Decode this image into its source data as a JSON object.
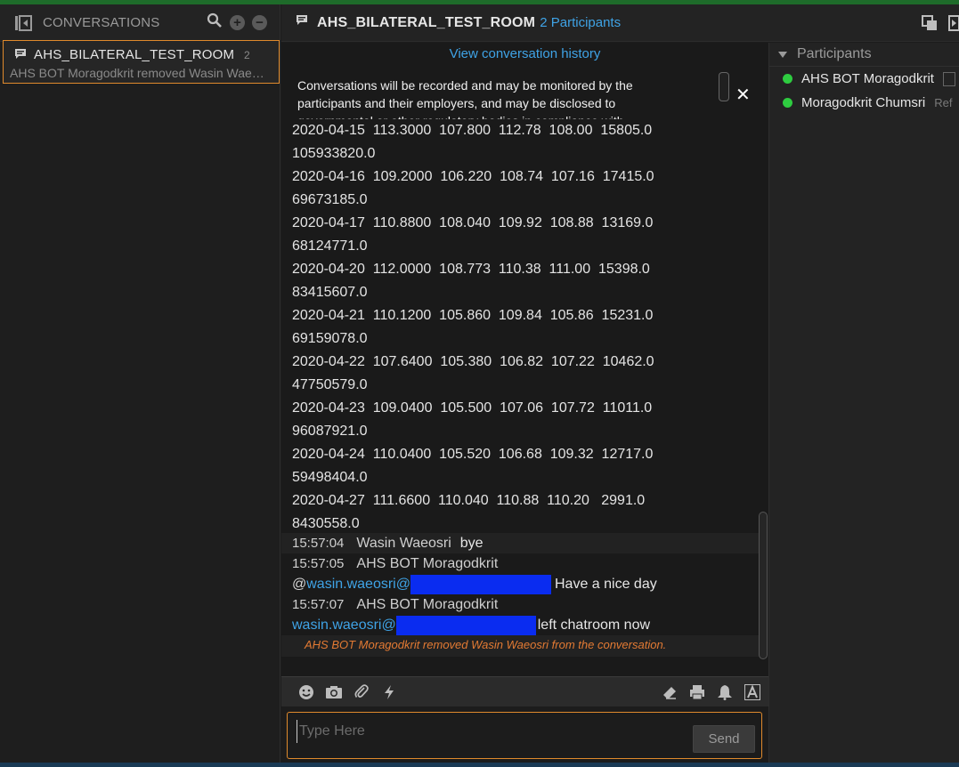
{
  "sidebar": {
    "title": "CONVERSATIONS",
    "conversations": [
      {
        "name": "AHS_BILATERAL_TEST_ROOM",
        "count": "2",
        "preview": "AHS BOT Moragodkrit removed Wasin Waeosri from the conversation."
      }
    ]
  },
  "header": {
    "room_title": "AHS_BILATERAL_TEST_ROOM",
    "participants_link": "2 Participants"
  },
  "chat": {
    "history_link": "View conversation history",
    "notice": "Conversations will be recorded and may be monitored by the participants and their employers, and may be disclosed to governmental or other regulatory bodies in compliance with",
    "data_rows": [
      {
        "line1": "2020-04-15  113.3000  107.800  112.78  108.00  15805.0",
        "line2": "105933820.0"
      },
      {
        "line1": "2020-04-16  109.2000  106.220  108.74  107.16  17415.0",
        "line2": "69673185.0"
      },
      {
        "line1": "2020-04-17  110.8800  108.040  109.92  108.88  13169.0",
        "line2": "68124771.0"
      },
      {
        "line1": "2020-04-20  112.0000  108.773  110.38  111.00  15398.0",
        "line2": "83415607.0"
      },
      {
        "line1": "2020-04-21  110.1200  105.860  109.84  105.86  15231.0",
        "line2": "69159078.0"
      },
      {
        "line1": "2020-04-22  107.6400  105.380  106.82  107.22  10462.0",
        "line2": "47750579.0"
      },
      {
        "line1": "2020-04-23  109.0400  105.500  107.06  107.72  11011.0",
        "line2": "96087921.0"
      },
      {
        "line1": "2020-04-24  110.0400  105.520  106.68  109.32  12717.0",
        "line2": "59498404.0"
      },
      {
        "line1": "2020-04-27  111.6600  110.040  110.88  110.20   2991.0",
        "line2": "8430558.0"
      }
    ],
    "messages": [
      {
        "time": "15:57:04",
        "sender": "Wasin Waeosri",
        "text": "bye"
      },
      {
        "time": "15:57:05",
        "sender": "AHS BOT Moragodkrit",
        "mention_prefix": "@",
        "mention": "wasin.waeosri@",
        "text": "Have a nice day"
      },
      {
        "time": "15:57:07",
        "sender": "AHS BOT Moragodkrit",
        "mention": "wasin.waeosri@",
        "text": "left chatroom now"
      }
    ],
    "system_message": "AHS BOT Moragodkrit removed Wasin Waeosri from the conversation."
  },
  "composer": {
    "placeholder": "Type Here",
    "send_label": "Send"
  },
  "participants_panel": {
    "title": "Participants",
    "items": [
      {
        "name": "AHS BOT Moragodkrit",
        "status": "online"
      },
      {
        "name": "Moragodkrit Chumsri",
        "extra": "Ref",
        "status": "online"
      }
    ]
  },
  "colors": {
    "accent": "#e08a2c",
    "link": "#3fa3e6",
    "online": "#2ecc40",
    "system": "#e37a33",
    "redaction": "#0a2cf0"
  }
}
